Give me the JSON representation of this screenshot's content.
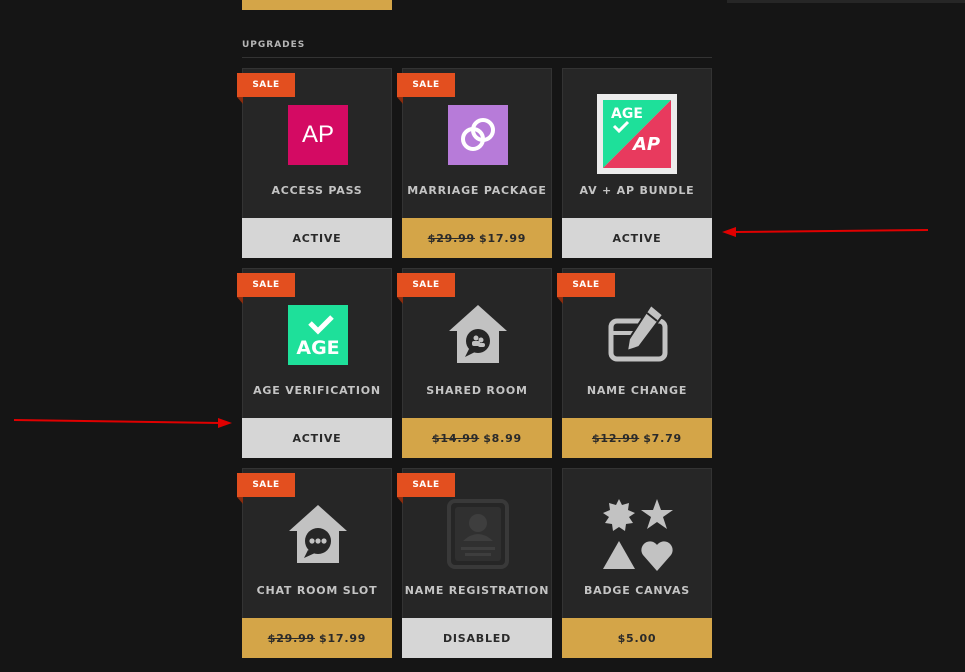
{
  "section": {
    "title": "UPGRADES"
  },
  "sale_label": "SALE",
  "cards": [
    {
      "name": "ACCESS PASS",
      "status": "ACTIVE",
      "icon": "access-pass-icon",
      "icon_text": "AP"
    },
    {
      "name": "MARRIAGE PACKAGE",
      "old_price": "$29.99",
      "price": "$17.99",
      "icon": "rings-icon"
    },
    {
      "name": "AV + AP BUNDLE",
      "status": "ACTIVE",
      "icon": "age-ap-bundle-icon",
      "icon_text_top": "AGE",
      "icon_text_bottom": "AP"
    },
    {
      "name": "AGE VERIFICATION",
      "status": "ACTIVE",
      "icon": "age-verification-icon",
      "icon_text": "AGE"
    },
    {
      "name": "SHARED ROOM",
      "old_price": "$14.99",
      "price": "$8.99",
      "icon": "shared-room-icon"
    },
    {
      "name": "NAME CHANGE",
      "old_price": "$12.99",
      "price": "$7.79",
      "icon": "pencil-icon"
    },
    {
      "name": "CHAT ROOM SLOT",
      "old_price": "$29.99",
      "price": "$17.99",
      "icon": "chat-room-icon"
    },
    {
      "name": "NAME REGISTRATION",
      "status": "DISABLED",
      "icon": "id-card-icon"
    },
    {
      "name": "BADGE CANVAS",
      "price": "$5.00",
      "icon": "badge-shapes-icon"
    }
  ],
  "colors": {
    "background": "#151515",
    "card": "#262626",
    "gold": "#d4a548",
    "sale": "#e34f1f",
    "active": "#d6d6d6",
    "access_pass": "#d40a63",
    "marriage": "#b77bd9",
    "age_green": "#1ee09a",
    "annotation_arrow": "#e00000"
  }
}
